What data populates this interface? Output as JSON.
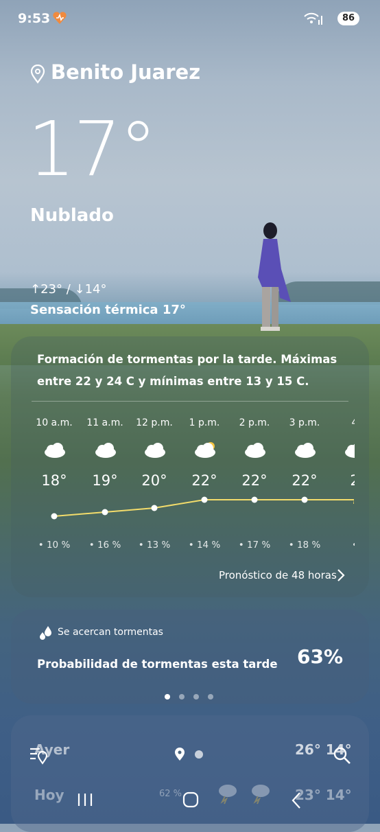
{
  "status_bar": {
    "time": "9:53",
    "battery": "86"
  },
  "location": "Benito Juarez",
  "current": {
    "temperature": "17°",
    "condition": "Nublado",
    "high_low": "↑23° / ↓14°",
    "feels_like": "Sensación térmica 17°"
  },
  "forecast": {
    "summary": "Formación de tormentas por la tarde. Máximas entre 22 y 24 C y mínimas entre 13 y 15 C.",
    "hours": [
      {
        "time": "10 a.m.",
        "icon": "cloud-icon",
        "temp": "18°",
        "precip": "10 %",
        "value": 18
      },
      {
        "time": "11 a.m.",
        "icon": "cloud-icon",
        "temp": "19°",
        "precip": "16 %",
        "value": 19
      },
      {
        "time": "12 p.m.",
        "icon": "cloud-icon",
        "temp": "20°",
        "precip": "13 %",
        "value": 20
      },
      {
        "time": "1 p.m.",
        "icon": "partly-sunny-icon",
        "temp": "22°",
        "precip": "14 %",
        "value": 22
      },
      {
        "time": "2 p.m.",
        "icon": "cloud-icon",
        "temp": "22°",
        "precip": "17 %",
        "value": 22
      },
      {
        "time": "3 p.m.",
        "icon": "cloud-icon",
        "temp": "22°",
        "precip": "18 %",
        "value": 22
      },
      {
        "time": "4",
        "icon": "cloud-icon",
        "temp": "2",
        "precip": "",
        "value": 22
      }
    ],
    "link_label": "Pronóstico de 48 horas"
  },
  "storm_alert": {
    "title": "Se acercan tormentas",
    "description": "Probabilidad de tormentas esta tarde",
    "probability": "63%"
  },
  "daily": {
    "yesterday_label": "Ayer",
    "yesterday_temps": "26° 14°",
    "today_label": "Hoy",
    "today_precip": "62 %",
    "today_temps": "23° 14°"
  },
  "colors": {
    "trend_line": "#f3dc6b",
    "sun": "#f5c542"
  }
}
